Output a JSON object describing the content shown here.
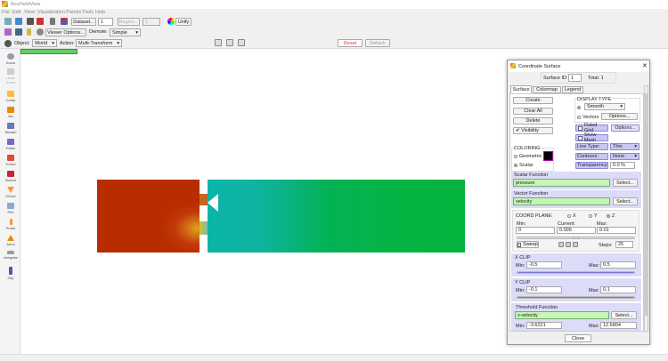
{
  "app": {
    "title": "AcuFieldView"
  },
  "menu": [
    "File",
    "Edit",
    "View",
    "Visualization Panels",
    "Tools",
    "Help"
  ],
  "toolbar1": {
    "dataset_label": "Dataset...",
    "dataset_value": "1",
    "region_label": "Region...",
    "region_value": "1",
    "unify_label": "Unify"
  },
  "toolbar2": {
    "viewer_options_label": "Viewer Options...",
    "demote_label": "Demote:",
    "demote_value": "Simple"
  },
  "toolbar3": {
    "object_label": "Object:",
    "object_value": "World",
    "action_label": "Action:",
    "action_value": "Multi-Transform",
    "reset_label": "Reset",
    "detach_label": "Detach"
  },
  "sidebar": [
    {
      "label": "Zoom"
    },
    {
      "label": "Undo Zoom"
    },
    {
      "label": "Comp"
    },
    {
      "label": "Iso"
    },
    {
      "label": "Stream"
    },
    {
      "label": "Paths"
    },
    {
      "label": "Coord"
    },
    {
      "label": "Bound"
    },
    {
      "label": "VCore"
    },
    {
      "label": "Plot"
    },
    {
      "label": "Probe"
    },
    {
      "label": "Anno"
    },
    {
      "label": "Integrate"
    },
    {
      "label": "Clip"
    }
  ],
  "dialog": {
    "title": "Coordinate Surface",
    "surface_id_label": "Surface ID:",
    "surface_id": "1",
    "total": "Total: 1",
    "tabs": [
      "Surface",
      "Colormap",
      "Legend"
    ],
    "create": "Create",
    "clear_all": "Clear All",
    "delete": "Delete",
    "visibility": "Visibility",
    "display_type": "DISPLAY TYPE",
    "smooth": "Smooth",
    "vectors": "Vectors",
    "options": "Options...",
    "ruled_grid": "Ruled Grid",
    "show_mesh": "Show Mesh",
    "line_type": "Line Type:",
    "line_type_value": "Thin",
    "contours": "Contours:",
    "contours_value": "None",
    "transparency": "Transparency:",
    "transparency_value": "0.0 %",
    "coloring": "COLORING",
    "geometric": "Geometric",
    "scalar": "Scalar",
    "color_swatch": "#000000",
    "scalar_function": "Scalar Function",
    "scalar_value": "pressure",
    "select": "Select...",
    "vector_function": "Vector Function",
    "vector_value": "velocity",
    "coord_plane": "COORD PLANE:",
    "x": "X",
    "y": "Y",
    "z": "Z",
    "min": "Min:",
    "current": "Current:",
    "max": "Max:",
    "plane_min": "0",
    "plane_current": "0.005",
    "plane_max": "0.01",
    "sweep": "Sweep",
    "steps": "Steps:",
    "steps_value": "25",
    "x_clip": "X CLIP",
    "x_min": "-0.5",
    "x_max": "0.5",
    "y_clip": "Y CLIP",
    "y_min": "-0.1",
    "y_max": "0.1",
    "threshold_function": "Threshold Function",
    "threshold_value": "x-velocity",
    "t_min": "-3.6221",
    "t_max": "12.6804",
    "close": "Close"
  }
}
